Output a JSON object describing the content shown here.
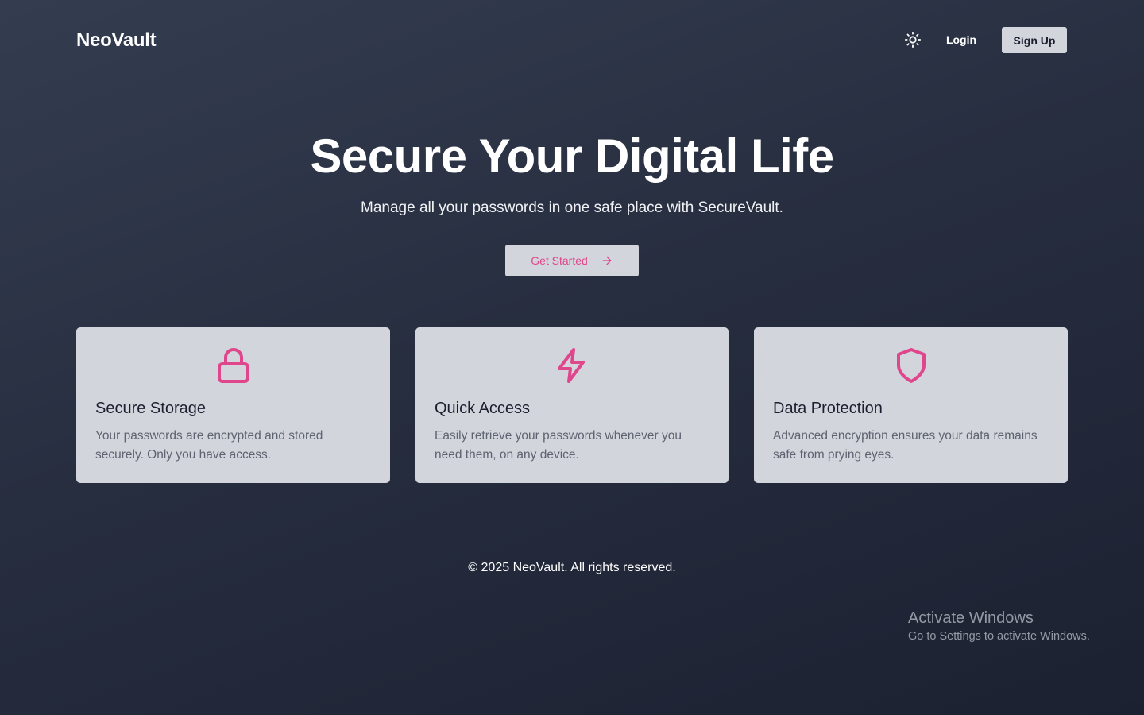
{
  "nav": {
    "brand": "NeoVault",
    "theme_icon": "sun-icon",
    "login_label": "Login",
    "signup_label": "Sign Up"
  },
  "hero": {
    "title": "Secure Your Digital Life",
    "subtitle": "Manage all your passwords in one safe place with SecureVault.",
    "cta_label": "Get Started",
    "cta_icon": "arrow-right-icon"
  },
  "features": [
    {
      "icon": "lock-icon",
      "title": "Secure Storage",
      "description": "Your passwords are encrypted and stored securely. Only you have access."
    },
    {
      "icon": "lightning-icon",
      "title": "Quick Access",
      "description": "Easily retrieve your passwords whenever you need them, on any device."
    },
    {
      "icon": "shield-icon",
      "title": "Data Protection",
      "description": "Advanced encryption ensures your data remains safe from prying eyes."
    }
  ],
  "footer": {
    "copyright": "© 2025 NeoVault. All rights reserved."
  },
  "os_watermark": {
    "title": "Activate Windows",
    "subtitle": "Go to Settings to activate Windows."
  },
  "colors": {
    "accent": "#e0468c",
    "card_bg": "#d3d5dc",
    "bg_dark": "#1c2131",
    "bg_light": "#343d50"
  }
}
